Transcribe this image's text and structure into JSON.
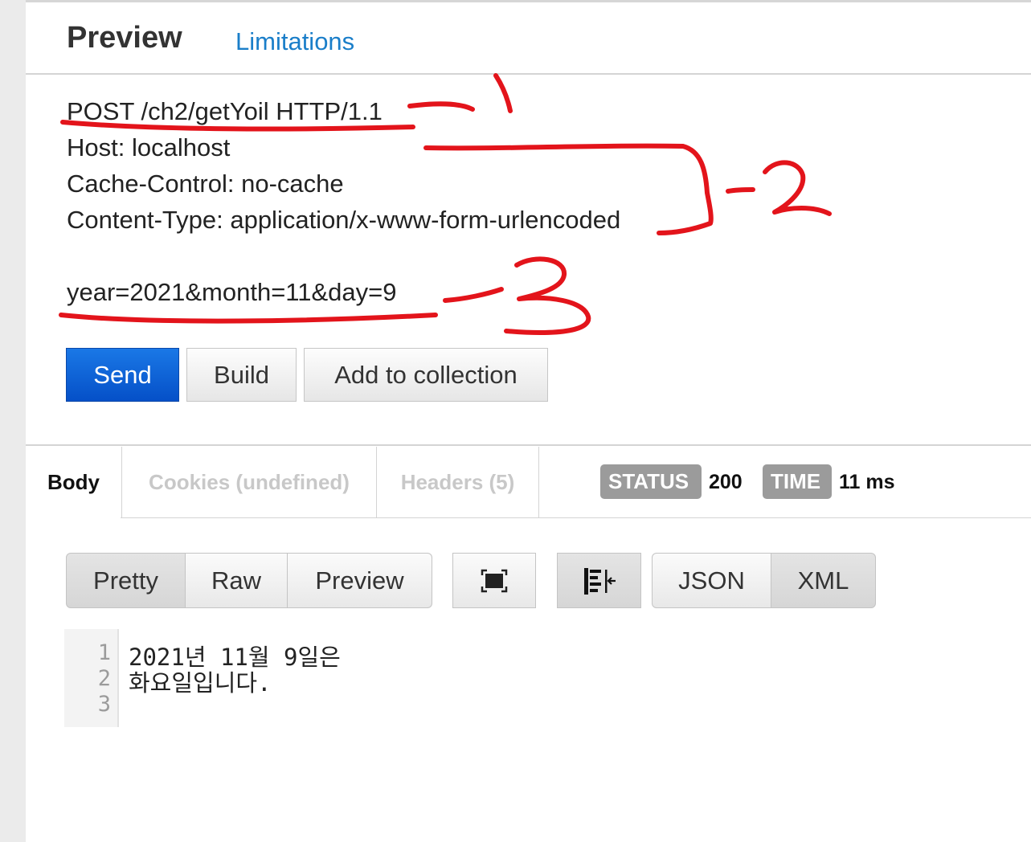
{
  "top_tabs": {
    "preview": "Preview",
    "limitations": "Limitations"
  },
  "request": {
    "line1": "POST /ch2/getYoil HTTP/1.1",
    "line2": "Host: localhost",
    "line3": "Cache-Control: no-cache",
    "line4": "Content-Type: application/x-www-form-urlencoded",
    "body": "year=2021&month=11&day=9"
  },
  "actions": {
    "send": "Send",
    "build": "Build",
    "add": "Add to collection"
  },
  "response_tabs": {
    "body": "Body",
    "cookies": "Cookies (undefined)",
    "headers": "Headers (5)"
  },
  "status": {
    "label": "STATUS",
    "value": "200"
  },
  "time": {
    "label": "TIME",
    "value": "11 ms"
  },
  "view": {
    "pretty": "Pretty",
    "raw": "Raw",
    "preview": "Preview",
    "json": "JSON",
    "xml": "XML"
  },
  "icons": {
    "fullscreen": "fullscreen-icon",
    "wrap": "wrap-lines-icon"
  },
  "response_lines": [
    "2021년 11월 9일은",
    "화요일입니다."
  ],
  "line_numbers": [
    "1",
    "2",
    "3"
  ],
  "annotations": [
    "1",
    "2",
    "3"
  ],
  "colors": {
    "send_blue": "#0a5fd6",
    "link_blue": "#1a7ec9",
    "badge_gray": "#9b9b9b",
    "annotation_red": "#e3141b"
  }
}
